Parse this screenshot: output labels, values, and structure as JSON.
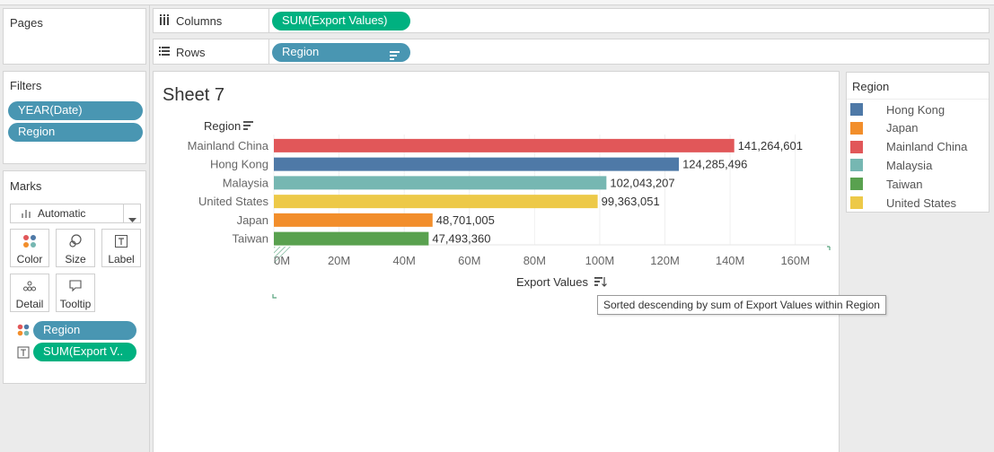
{
  "pages": {
    "title": "Pages"
  },
  "filters": {
    "title": "Filters",
    "pills": [
      "YEAR(Date)",
      "Region"
    ]
  },
  "marks": {
    "title": "Marks",
    "mark_type": "Automatic",
    "buttons": [
      "Color",
      "Size",
      "Label",
      "Detail",
      "Tooltip"
    ],
    "pills": [
      "Region",
      "SUM(Export V.."
    ]
  },
  "shelves": {
    "columns_label": "Columns",
    "columns_pill": "SUM(Export Values)",
    "rows_label": "Rows",
    "rows_pill": "Region"
  },
  "sheet": {
    "title": "Sheet 7"
  },
  "tooltip": "Sorted descending by sum of Export Values within Region",
  "legend": {
    "title": "Region",
    "items": [
      {
        "label": "Hong Kong",
        "color": "#4e79a7"
      },
      {
        "label": "Japan",
        "color": "#f28e2b"
      },
      {
        "label": "Mainland China",
        "color": "#e15759"
      },
      {
        "label": "Malaysia",
        "color": "#76b7b2"
      },
      {
        "label": "Taiwan",
        "color": "#59a14f"
      },
      {
        "label": "United States",
        "color": "#edc948"
      }
    ]
  },
  "chart_data": {
    "type": "bar",
    "orientation": "horizontal",
    "ylabel": "Region",
    "xlabel": "Export Values",
    "xlim": [
      0,
      170000000
    ],
    "x_ticks": [
      "0M",
      "20M",
      "40M",
      "60M",
      "80M",
      "100M",
      "120M",
      "140M",
      "160M"
    ],
    "categories": [
      "Mainland China",
      "Hong Kong",
      "Malaysia",
      "United States",
      "Japan",
      "Taiwan"
    ],
    "values": [
      141264601,
      124285496,
      102043207,
      99363051,
      48701005,
      47493360
    ],
    "value_labels": [
      "141,264,601",
      "124,285,496",
      "102,043,207",
      "99,363,051",
      "48,701,005",
      "47,493,360"
    ],
    "colors": [
      "#e15759",
      "#4e79a7",
      "#76b7b2",
      "#edc948",
      "#f28e2b",
      "#59a14f"
    ]
  }
}
